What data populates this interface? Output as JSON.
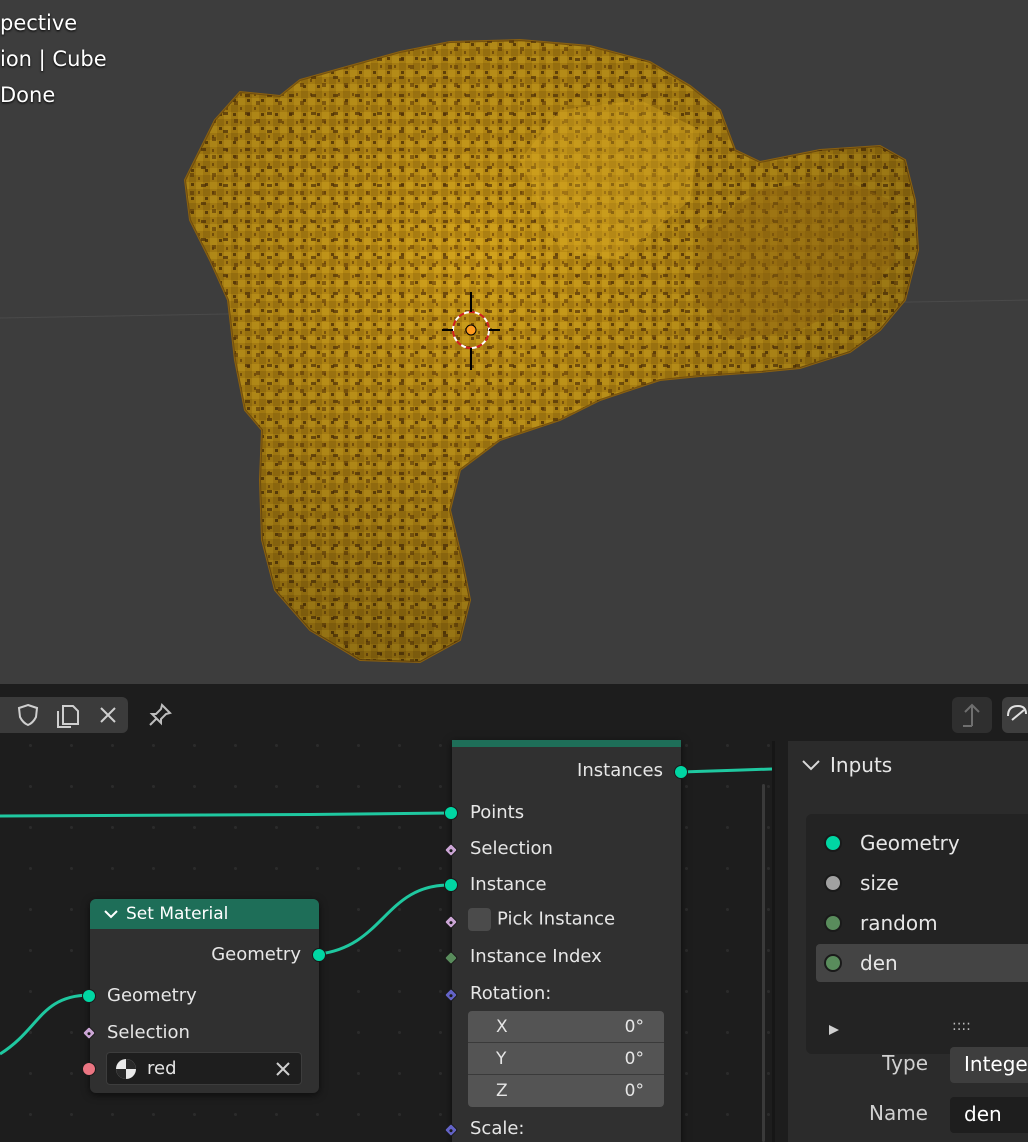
{
  "viewport": {
    "overlay_lines": [
      "pective",
      "ion | Cube",
      " Done"
    ],
    "background": "#3d3d3d",
    "object_color": "#c39215"
  },
  "header": {
    "icons": [
      "fake-user-shield-icon",
      "duplicate-icon",
      "close-icon",
      "pin-icon",
      "parent-node-tree-icon",
      "snap-icon"
    ]
  },
  "nodes": {
    "instance_on_points": {
      "output_instances": "Instances",
      "input_points": "Points",
      "input_selection": "Selection",
      "input_instance": "Instance",
      "input_pick_instance": "Pick Instance",
      "input_instance_index": "Instance Index",
      "input_rotation": "Rotation:",
      "rotation": [
        {
          "axis": "X",
          "value": "0°"
        },
        {
          "axis": "Y",
          "value": "0°"
        },
        {
          "axis": "Z",
          "value": "0°"
        }
      ],
      "input_scale": "Scale:"
    },
    "set_material": {
      "title": "Set Material",
      "output_geometry": "Geometry",
      "input_geometry": "Geometry",
      "input_selection": "Selection",
      "material": "red"
    }
  },
  "sidebar": {
    "panel_title": "Inputs",
    "inputs": [
      {
        "name": "Geometry",
        "color": "#00d6a3"
      },
      {
        "name": "size",
        "color": "#a1a1a1"
      },
      {
        "name": "random",
        "color": "#598c5c"
      },
      {
        "name": "den",
        "color": "#598c5c"
      }
    ],
    "active_index": 3,
    "type_label": "Type",
    "type_value": "Intege",
    "name_label": "Name",
    "name_value": "den"
  },
  "colors": {
    "geometry_socket": "#00d6a3",
    "node_header": "#1e6e58",
    "link": "#1fc8a0"
  }
}
